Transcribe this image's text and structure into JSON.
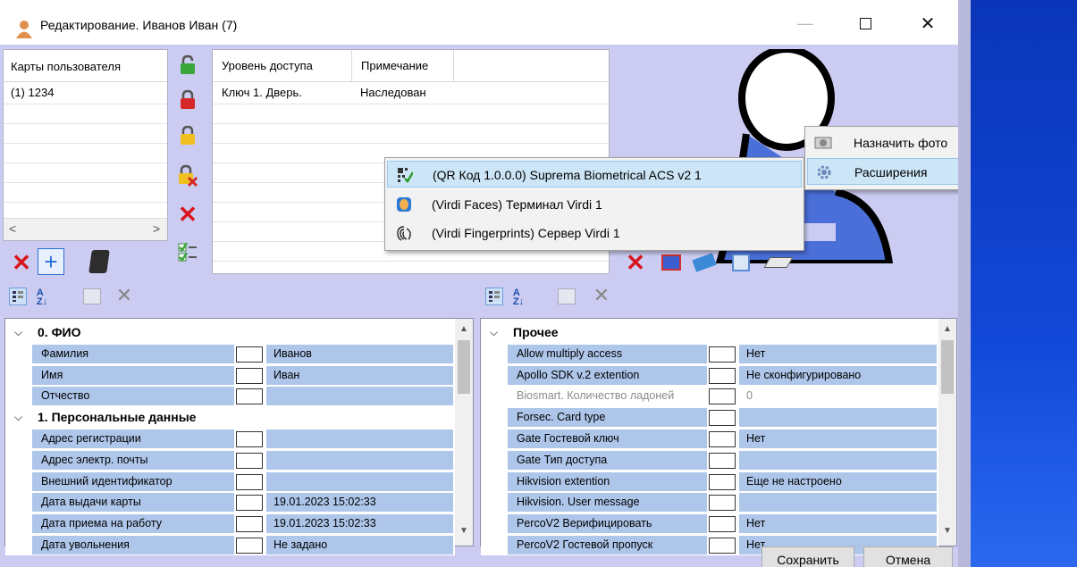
{
  "window": {
    "title": "Редактирование. Иванов Иван (7)"
  },
  "cards": {
    "header": "Карты пользователя",
    "items": [
      "(1) 1234"
    ]
  },
  "access": {
    "col_level": "Уровень доступа",
    "col_note": "Примечание",
    "rows": [
      {
        "level": "Ключ 1. Дверь.",
        "note": "Наследован"
      }
    ]
  },
  "context_menu": {
    "items": [
      "Назначить фото",
      "Расширения"
    ]
  },
  "submenu": {
    "items": [
      "(QR Код 1.0.0.0) Suprema Biometrical ACS v2 1",
      "(Virdi Faces) Терминал Virdi 1",
      "(Virdi Fingerprints) Сервер Virdi 1"
    ]
  },
  "left_grid": {
    "rows": [
      {
        "type": "section",
        "name": "0. ФИО"
      },
      {
        "type": "row",
        "name": "Фамилия",
        "value": "Иванов",
        "hl": true
      },
      {
        "type": "row",
        "name": "Имя",
        "value": "Иван",
        "hl": true
      },
      {
        "type": "row",
        "name": "Отчество",
        "value": "",
        "hl": true
      },
      {
        "type": "section",
        "name": "1. Персональные данные"
      },
      {
        "type": "row",
        "name": "Адрес регистрации",
        "value": "",
        "hl": true
      },
      {
        "type": "row",
        "name": "Адрес электр. почты",
        "value": "",
        "hl": true
      },
      {
        "type": "row",
        "name": "Внешний идентификатор",
        "value": "",
        "hl": true
      },
      {
        "type": "row",
        "name": "Дата выдачи карты",
        "value": "19.01.2023 15:02:33",
        "hl": true
      },
      {
        "type": "row",
        "name": "Дата приема на работу",
        "value": "19.01.2023 15:02:33",
        "hl": true
      },
      {
        "type": "row",
        "name": "Дата увольнения",
        "value": "Не задано",
        "hl": true
      }
    ]
  },
  "right_grid": {
    "rows": [
      {
        "type": "section",
        "name": "Прочее"
      },
      {
        "type": "row",
        "name": "Allow multiply access",
        "value": "Нет",
        "hl": true
      },
      {
        "type": "row",
        "name": "Apollo SDK v.2 extention",
        "value": "Не сконфигурировано",
        "hl": true
      },
      {
        "type": "row",
        "name": "Biosmart. Количество ладоней",
        "value": "0",
        "hl": false
      },
      {
        "type": "row",
        "name": "Forsec. Card type",
        "value": "",
        "hl": true
      },
      {
        "type": "row",
        "name": "Gate Гостевой ключ",
        "value": "Нет",
        "hl": true
      },
      {
        "type": "row",
        "name": "Gate Тип доступа",
        "value": "",
        "hl": true
      },
      {
        "type": "row",
        "name": "Hikvision extention",
        "value": "Еще не настроено",
        "hl": true
      },
      {
        "type": "row",
        "name": "Hikvision. User message",
        "value": "",
        "hl": true
      },
      {
        "type": "row",
        "name": "PercoV2 Верифицировать",
        "value": "Нет",
        "hl": true
      },
      {
        "type": "row",
        "name": "PercoV2 Гостевой пропуск",
        "value": "Нет",
        "hl": true
      }
    ]
  },
  "buttons": {
    "save": "Сохранить",
    "cancel": "Отмена"
  }
}
